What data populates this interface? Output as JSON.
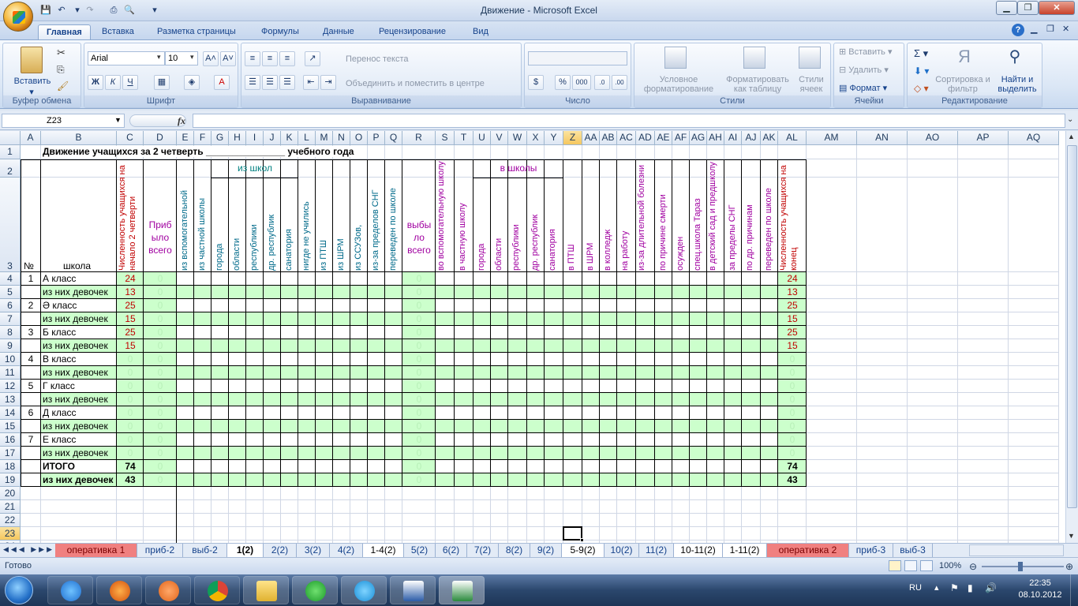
{
  "window": {
    "title": "Движение - Microsoft Excel"
  },
  "tabs": [
    "Главная",
    "Вставка",
    "Разметка страницы",
    "Формулы",
    "Данные",
    "Рецензирование",
    "Вид"
  ],
  "active_tab": "Главная",
  "ribbon": {
    "clipboard": {
      "label": "Буфер обмена",
      "paste": "Вставить"
    },
    "font": {
      "label": "Шрифт",
      "name": "Arial",
      "size": "10",
      "bold": "Ж",
      "italic": "К",
      "underline": "Ч"
    },
    "alignment": {
      "label": "Выравнивание",
      "wrap": "Перенос текста",
      "merge": "Объединить и поместить в центре"
    },
    "number": {
      "label": "Число",
      "format": "",
      "percent": "%",
      "thousands": "000"
    },
    "styles": {
      "label": "Стили",
      "conditional": "Условное форматирование",
      "as_table": "Форматировать как таблицу",
      "cell_styles": "Стили ячеек"
    },
    "cells": {
      "label": "Ячейки",
      "insert": "Вставить",
      "delete": "Удалить",
      "format": "Формат"
    },
    "editing": {
      "label": "Редактирование",
      "sort": "Сортировка и фильтр",
      "find": "Найти и выделить"
    }
  },
  "formula_bar": {
    "name_box": "Z23",
    "fx": "fx",
    "value": ""
  },
  "columns": [
    "A",
    "B",
    "C",
    "D",
    "E",
    "F",
    "G",
    "H",
    "I",
    "J",
    "K",
    "L",
    "M",
    "N",
    "O",
    "P",
    "Q",
    "R",
    "S",
    "T",
    "U",
    "V",
    "W",
    "X",
    "Y",
    "Z",
    "AA",
    "AB",
    "AC",
    "AD",
    "AE",
    "AF",
    "AG",
    "AH",
    "AI",
    "AJ",
    "AK",
    "AL",
    "AM",
    "AN",
    "AO",
    "AP",
    "AQ"
  ],
  "rows": [
    "1",
    "2",
    "3",
    "4",
    "5",
    "6",
    "7",
    "8",
    "9",
    "10",
    "11",
    "12",
    "13",
    "14",
    "15",
    "16",
    "17",
    "18",
    "19",
    "20",
    "21",
    "22",
    "23",
    "24"
  ],
  "sheet": {
    "title": "Движение учащихся за 2 четверть _______________ учебного года",
    "col_no": "№",
    "col_school": "школа",
    "arrived_total": "Приб ыло всего",
    "left_total": "выбы ло всего",
    "from_schools": "из школ",
    "to_schools": "в школы",
    "vertical_headers": [
      "Численность учащихся на начало 2 четверти",
      "из вспомогательной",
      "из частной школы",
      "города",
      "области",
      "республики",
      "др. республик",
      "санатория",
      "нигде не учились",
      "из ПТШ",
      "из ШРМ",
      "из ССУЗов,",
      "из-за пределов СНГ",
      "переведен по школе",
      "во вспомогательную школу",
      "в частную школу",
      "города",
      "области",
      "республики",
      "др. республик",
      "санатория",
      "в ПТШ",
      "в ШРМ",
      "в колледж",
      "на работу",
      "из-за длительной болезни",
      "по причине смерти",
      "осужден",
      "спец.школа Тараз",
      "в детский сад и предшколу",
      "за пределы СНГ",
      "по др. причинам",
      "переведен по школе",
      "Численность учащихся на конец"
    ],
    "data_rows": [
      {
        "no": "1",
        "name": "А класс",
        "start": "24",
        "arrived": "0",
        "left": "0",
        "end": "24"
      },
      {
        "no": "",
        "name": "из них девочек",
        "start": "13",
        "arrived": "0",
        "left": "0",
        "end": "13"
      },
      {
        "no": "2",
        "name": "Ә класс",
        "start": "25",
        "arrived": "0",
        "left": "0",
        "end": "25"
      },
      {
        "no": "",
        "name": "из них девочек",
        "start": "15",
        "arrived": "0",
        "left": "0",
        "end": "15"
      },
      {
        "no": "3",
        "name": "Б класс",
        "start": "25",
        "arrived": "0",
        "left": "0",
        "end": "25"
      },
      {
        "no": "",
        "name": "из них девочек",
        "start": "15",
        "arrived": "0",
        "left": "0",
        "end": "15"
      },
      {
        "no": "4",
        "name": "В класс",
        "start": "0",
        "arrived": "0",
        "left": "0",
        "end": "0"
      },
      {
        "no": "",
        "name": "из них девочек",
        "start": "0",
        "arrived": "0",
        "left": "0",
        "end": "0"
      },
      {
        "no": "5",
        "name": "Г класс",
        "start": "0",
        "arrived": "0",
        "left": "0",
        "end": "0"
      },
      {
        "no": "",
        "name": "из них девочек",
        "start": "0",
        "arrived": "0",
        "left": "0",
        "end": "0"
      },
      {
        "no": "6",
        "name": "Д класс",
        "start": "0",
        "arrived": "0",
        "left": "0",
        "end": "0"
      },
      {
        "no": "",
        "name": "из них девочек",
        "start": "0",
        "arrived": "0",
        "left": "0",
        "end": "0"
      },
      {
        "no": "7",
        "name": "Е класс",
        "start": "0",
        "arrived": "0",
        "left": "0",
        "end": "0"
      },
      {
        "no": "",
        "name": "из них девочек",
        "start": "0",
        "arrived": "0",
        "left": "0",
        "end": "0"
      },
      {
        "no": "",
        "name": "ИТОГО",
        "start": "74",
        "arrived": "0",
        "left": "0",
        "end": "74"
      },
      {
        "no": "",
        "name": "из них девочек",
        "start": "43",
        "arrived": "0",
        "left": "0",
        "end": "43"
      }
    ]
  },
  "sheet_tabs": [
    {
      "label": "оперативка 1",
      "style": "red"
    },
    {
      "label": "приб-2",
      "style": ""
    },
    {
      "label": "выб-2",
      "style": ""
    },
    {
      "label": "1(2)",
      "style": "active"
    },
    {
      "label": "2(2)",
      "style": ""
    },
    {
      "label": "3(2)",
      "style": ""
    },
    {
      "label": "4(2)",
      "style": ""
    },
    {
      "label": "1-4(2)",
      "style": "dark"
    },
    {
      "label": "5(2)",
      "style": ""
    },
    {
      "label": "6(2)",
      "style": ""
    },
    {
      "label": "7(2)",
      "style": ""
    },
    {
      "label": "8(2)",
      "style": ""
    },
    {
      "label": "9(2)",
      "style": ""
    },
    {
      "label": "5-9(2)",
      "style": "dark"
    },
    {
      "label": "10(2)",
      "style": ""
    },
    {
      "label": "11(2)",
      "style": ""
    },
    {
      "label": "10-11(2)",
      "style": "dark"
    },
    {
      "label": "1-11(2)",
      "style": "dark"
    },
    {
      "label": "оперативка 2",
      "style": "red"
    },
    {
      "label": "приб-3",
      "style": ""
    },
    {
      "label": "выб-3",
      "style": ""
    }
  ],
  "status": {
    "ready": "Готово",
    "zoom": "100%"
  },
  "taskbar": {
    "lang": "RU",
    "time": "22:35",
    "date": "08.10.2012"
  },
  "colors": {
    "green": "#ccffcc",
    "red_text": "#c00000",
    "purple": "#a000a0",
    "teal": "#008080",
    "grid": "#d0d7e5"
  }
}
